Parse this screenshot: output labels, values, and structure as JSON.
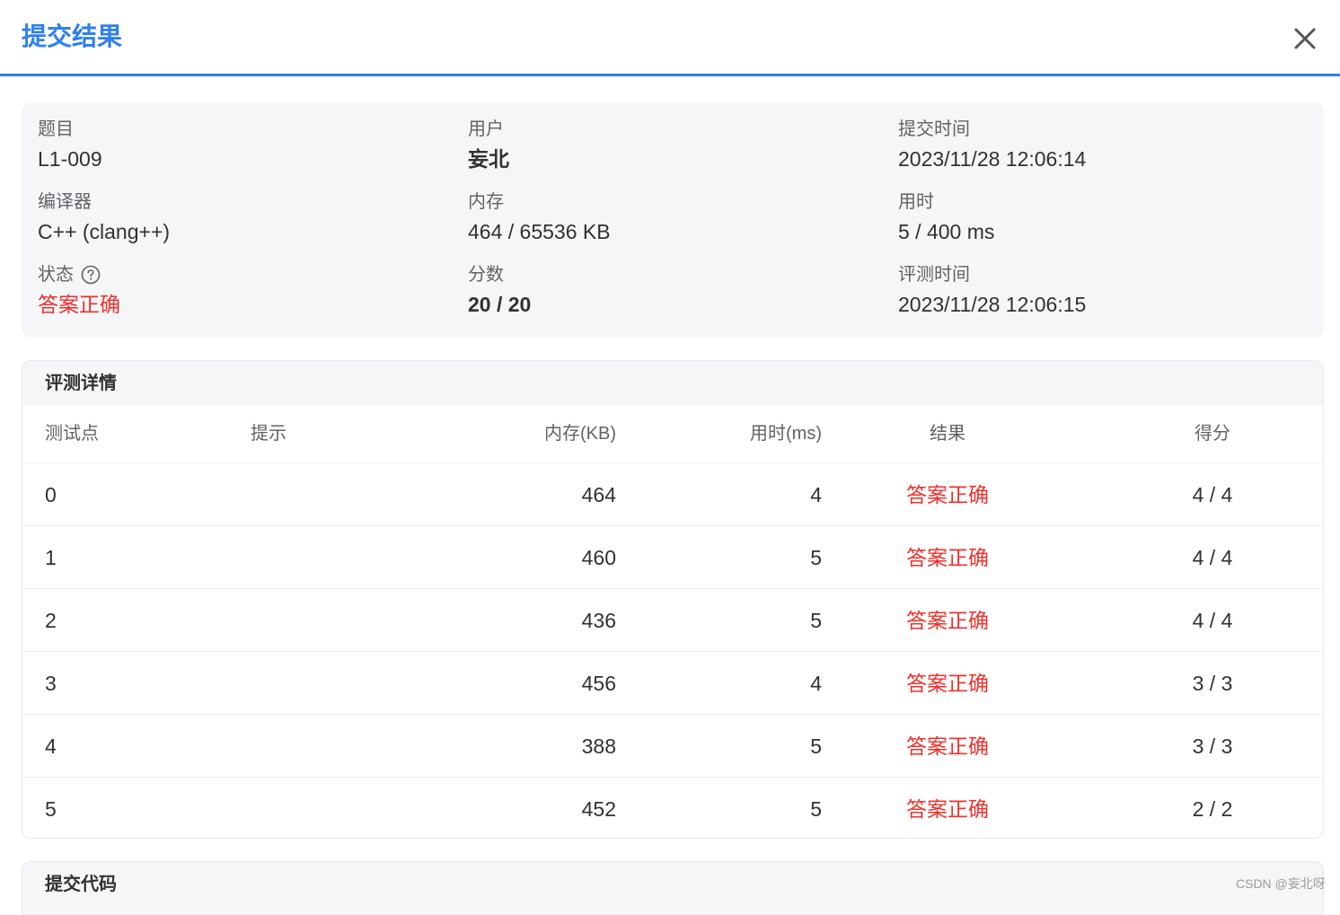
{
  "dialog": {
    "title": "提交结果"
  },
  "info": {
    "problem_label": "题目",
    "problem_value": "L1-009",
    "user_label": "用户",
    "user_value": "妄北",
    "submit_time_label": "提交时间",
    "submit_time_value": "2023/11/28 12:06:14",
    "compiler_label": "编译器",
    "compiler_value": "C++ (clang++)",
    "memory_label": "内存",
    "memory_value": "464 / 65536 KB",
    "time_label": "用时",
    "time_value": "5 / 400 ms",
    "status_label": "状态",
    "status_value": "答案正确",
    "score_label": "分数",
    "score_value": "20 / 20",
    "judge_time_label": "评测时间",
    "judge_time_value": "2023/11/28 12:06:15",
    "status_color": "#f0302b"
  },
  "details": {
    "title": "评测详情",
    "columns": {
      "case": "测试点",
      "hint": "提示",
      "memory": "内存(KB)",
      "time": "用时(ms)",
      "result": "结果",
      "score": "得分"
    },
    "rows": [
      {
        "case": "0",
        "hint": "",
        "memory": "464",
        "time": "4",
        "result": "答案正确",
        "score": "4 / 4"
      },
      {
        "case": "1",
        "hint": "",
        "memory": "460",
        "time": "5",
        "result": "答案正确",
        "score": "4 / 4"
      },
      {
        "case": "2",
        "hint": "",
        "memory": "436",
        "time": "5",
        "result": "答案正确",
        "score": "4 / 4"
      },
      {
        "case": "3",
        "hint": "",
        "memory": "456",
        "time": "4",
        "result": "答案正确",
        "score": "3 / 3"
      },
      {
        "case": "4",
        "hint": "",
        "memory": "388",
        "time": "5",
        "result": "答案正确",
        "score": "3 / 3"
      },
      {
        "case": "5",
        "hint": "",
        "memory": "452",
        "time": "5",
        "result": "答案正确",
        "score": "2 / 2"
      }
    ]
  },
  "code": {
    "title": "提交代码"
  },
  "watermark": "CSDN @妄北呀",
  "colors": {
    "accent": "#2f80ed",
    "success_text": "#f0302b",
    "panel_bg": "#f5f6f8"
  },
  "icons": {
    "close": "close-icon",
    "help": "question-circle-icon"
  }
}
